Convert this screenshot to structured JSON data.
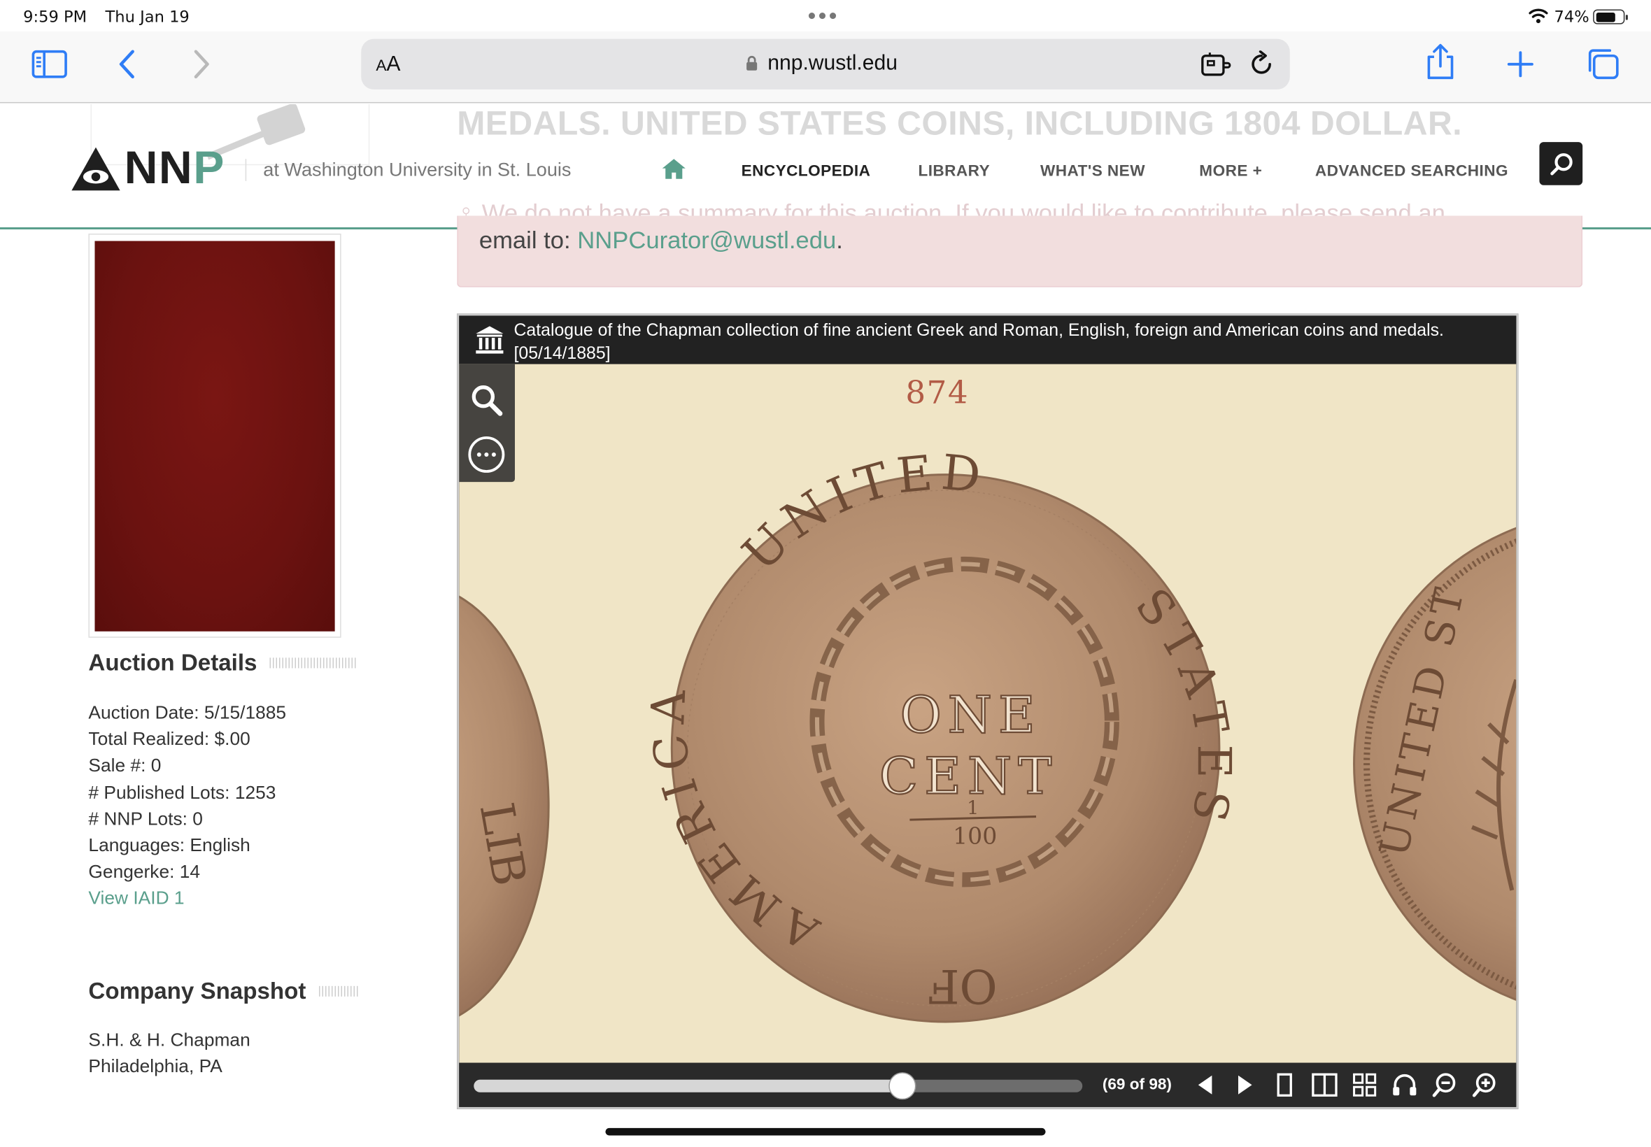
{
  "status_bar": {
    "time": "9:59 PM",
    "date": "Thu Jan 19",
    "battery_percent": "74%",
    "battery_level": 0.74
  },
  "browser": {
    "aa_label": "AA",
    "url": "nnp.wustl.edu",
    "icons": [
      "sidebar-icon",
      "back-icon",
      "forward-icon",
      "lock-icon",
      "extension-icon",
      "reload-icon",
      "share-icon",
      "new-tab-icon",
      "tabs-icon"
    ]
  },
  "site": {
    "logo_text": "NNP",
    "logo_sub": "at Washington University in St. Louis",
    "nav": {
      "encyclopedia": "ENCYCLOPEDIA",
      "library": "LIBRARY",
      "whats_new": "WHAT'S NEW",
      "more": "MORE +",
      "advanced": "ADVANCED SEARCHING"
    },
    "ghost_title": "MEDALS. UNITED STATES COINS, INCLUDING 1804 DOLLAR.",
    "ghost_summary": "♀ We do not have a summary for this auction. If you would like to contribute, please send an"
  },
  "notice": {
    "prefix": "email to: ",
    "email": "NNPCurator@wustl.edu",
    "suffix": "."
  },
  "auction_details": {
    "title": "Auction Details",
    "date": "Auction Date: 5/15/1885",
    "total": "Total Realized: $.00",
    "sale": "Sale #: 0",
    "published_lots": "# Published Lots: 1253",
    "nnp_lots": "# NNP Lots: 0",
    "languages": "Languages: English",
    "gengerke": "Gengerke: 14",
    "view_iaid": "View IAID 1"
  },
  "company": {
    "title": "Company Snapshot",
    "name": "S.H. & H. Chapman",
    "location": "Philadelphia, PA"
  },
  "viewer": {
    "title": "Catalogue of the Chapman collection of fine ancient Greek and Roman, English, foreign and American coins and medals. [05/14/1885]",
    "page_number": "874",
    "page_count": "(69 of 98)",
    "progress": 0.7041,
    "coin_legend_top": "UNITED",
    "coin_legend_left": "AMERICA",
    "coin_legend_right": "STATES",
    "coin_legend_bottom": "OF",
    "coin_center_1": "ONE",
    "coin_center_2": "CENT",
    "coin_fraction": "1",
    "coin_fraction_den": "100",
    "coin_right_legend": "UNITED ST",
    "coin_left_fragment": "LIB"
  }
}
